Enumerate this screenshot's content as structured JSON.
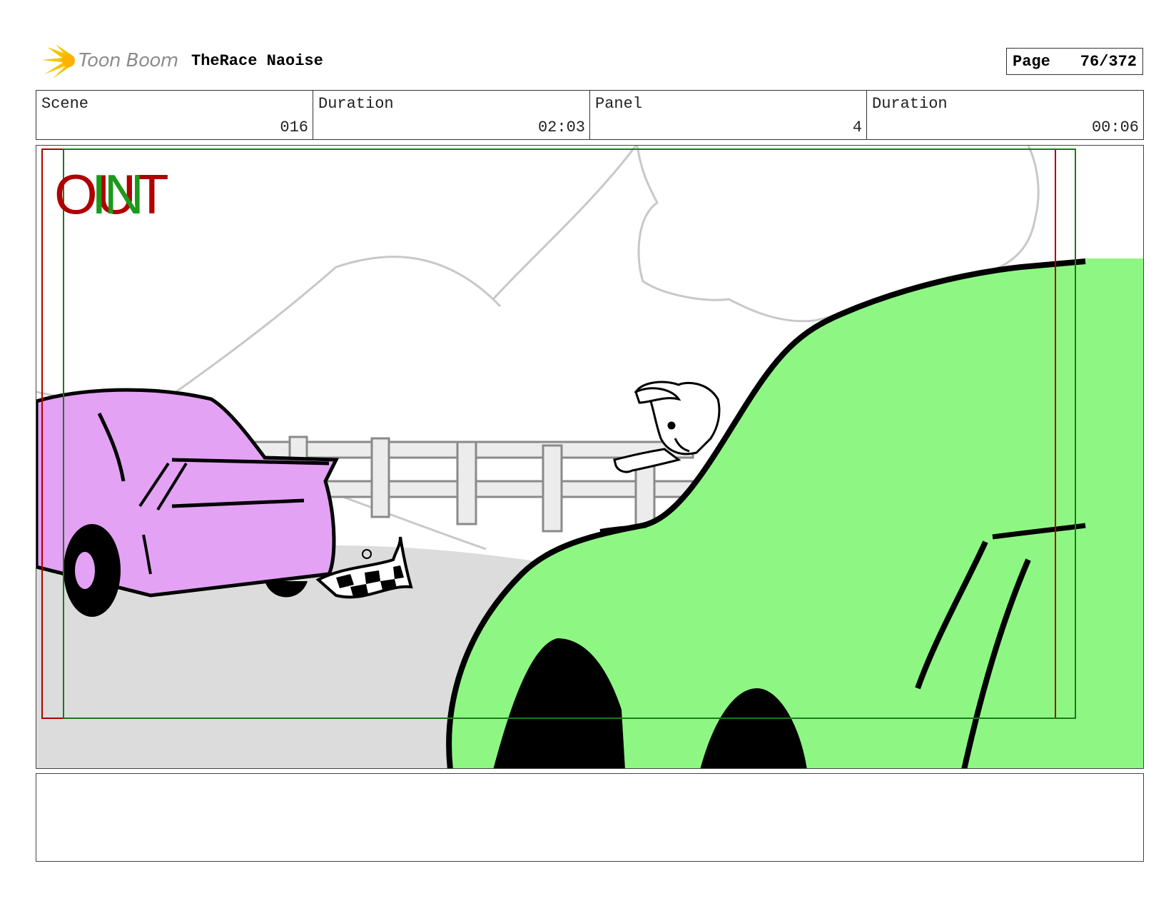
{
  "header": {
    "logo_text": "Toon Boom",
    "project_title": "TheRace Naoise",
    "page_label": "Page",
    "page_value": "76/372"
  },
  "info": {
    "scene_label": "Scene",
    "scene_value": "016",
    "scene_duration_label": "Duration",
    "scene_duration_value": "02:03",
    "panel_label": "Panel",
    "panel_value": "4",
    "panel_duration_label": "Duration",
    "panel_duration_value": "00:06"
  },
  "panel": {
    "out_label": "OUT",
    "in_label": "IN",
    "colors": {
      "out_frame": "#b00000",
      "in_frame": "#1a7a1a",
      "green_car": "#8ef784",
      "pink_car": "#e4a2f5",
      "road": "#dcdcdc"
    }
  },
  "notes": {
    "text": ""
  }
}
